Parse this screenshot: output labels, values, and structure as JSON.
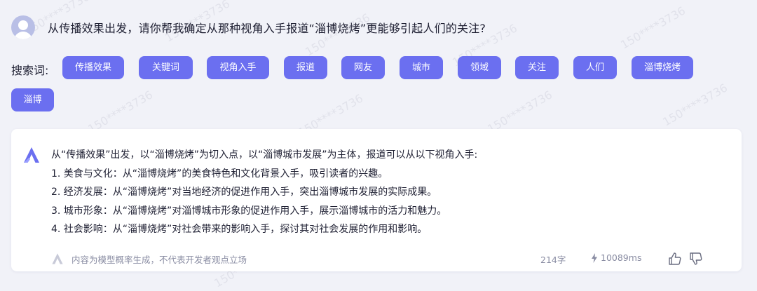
{
  "question": {
    "text": "从传播效果出发，请你帮我确定从那种视角入手报道“淄博烧烤”更能够引起人们的关注?"
  },
  "keywords": {
    "label": "搜索词:",
    "items": [
      "传播效果",
      "关键词",
      "视角入手",
      "报道",
      "网友",
      "城市",
      "领域",
      "关注",
      "人们",
      "淄博烧烤",
      "淄博"
    ]
  },
  "answer": {
    "lines": [
      "从“传播效果”出发，以“淄博烧烤”为切入点，以“淄博城市发展”为主体，报道可以从以下视角入手:",
      "1. 美食与文化：从“淄博烧烤”的美食特色和文化背景入手，吸引读者的兴趣。",
      "2. 经济发展：从“淄博烧烤”对当地经济的促进作用入手，突出淄博城市发展的实际成果。",
      "3. 城市形象：从“淄博烧烤”对淄博城市形象的促进作用入手，展示淄博城市的活力和魅力。",
      "4. 社会影响：从“淄博烧烤”对社会带来的影响入手，探讨其对社会发展的作用和影响。"
    ],
    "disclaimer": "内容为模型概率生成，不代表开发者观点立场",
    "word_count": "214字",
    "latency": "10089ms"
  },
  "watermark": "150****3736",
  "colors": {
    "chip": "#6b6ff0",
    "background": "#f1f2f8",
    "card": "#ffffff",
    "muted": "#8a8da3"
  },
  "icons": {
    "avatar": "user-avatar-icon",
    "answer_logo": "assistant-logo-icon",
    "footer_logo": "assistant-logo-small-icon",
    "latency": "lightning-icon",
    "like": "thumbs-up-icon",
    "dislike": "thumbs-down-icon"
  }
}
